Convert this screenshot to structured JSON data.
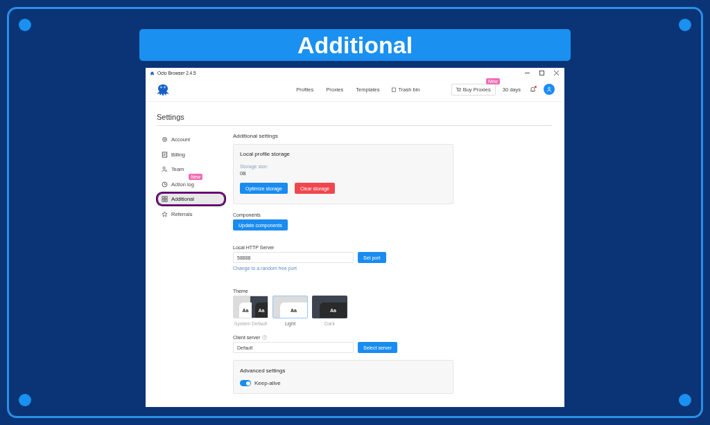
{
  "banner": {
    "title": "Additional"
  },
  "window": {
    "title": "Octo Browser 2.4.5"
  },
  "nav": [
    {
      "label": "Profiles",
      "kind": "text"
    },
    {
      "label": "Proxies",
      "kind": "text"
    },
    {
      "label": "Templates",
      "kind": "text"
    },
    {
      "label": "Trash bin",
      "kind": "trash"
    }
  ],
  "buy_proxies": {
    "label": "Buy Proxies",
    "badge": "New"
  },
  "subscription": "30 days",
  "notifications": {
    "unread": true
  },
  "page_title": "Settings",
  "sidebar": [
    {
      "label": "Account",
      "selected": false,
      "highlighted": false
    },
    {
      "label": "Billing",
      "selected": false,
      "highlighted": false
    },
    {
      "label": "Team",
      "selected": false,
      "highlighted": false
    },
    {
      "label": "Action log",
      "badge": "New",
      "selected": false,
      "highlighted": false
    },
    {
      "label": "Additional",
      "selected": true,
      "highlighted": true
    },
    {
      "label": "Referrals",
      "selected": false,
      "highlighted": false
    }
  ],
  "content": {
    "heading": "Additional settings",
    "storage": {
      "title": "Local profile storage",
      "size_label": "Storage size:",
      "size_value": "0B",
      "buttons": [
        {
          "label": "Optimize storage",
          "kind": "primary"
        },
        {
          "label": "Clear storage",
          "kind": "danger"
        }
      ]
    },
    "components": {
      "label": "Components",
      "button": "Update components"
    },
    "http_server": {
      "label": "Local HTTP Server",
      "value": "58888",
      "button": "Set port",
      "link": "Change to a random free port"
    },
    "theme": {
      "label": "Theme",
      "options": [
        {
          "label": "System Default",
          "kind": "system",
          "previews": [
            "Aa",
            "Aa"
          ],
          "selected": false
        },
        {
          "label": "Light",
          "kind": "light",
          "previews": [
            "Aa"
          ],
          "selected": true
        },
        {
          "label": "Dark",
          "kind": "dark",
          "previews": [
            "Aa"
          ],
          "selected": false
        }
      ]
    },
    "client_server": {
      "label": "Client server",
      "value": "Default",
      "button": "Select server"
    },
    "advanced": {
      "title": "Advanced settings",
      "toggles": [
        {
          "label": "Keep-alive",
          "on": true
        }
      ]
    }
  }
}
